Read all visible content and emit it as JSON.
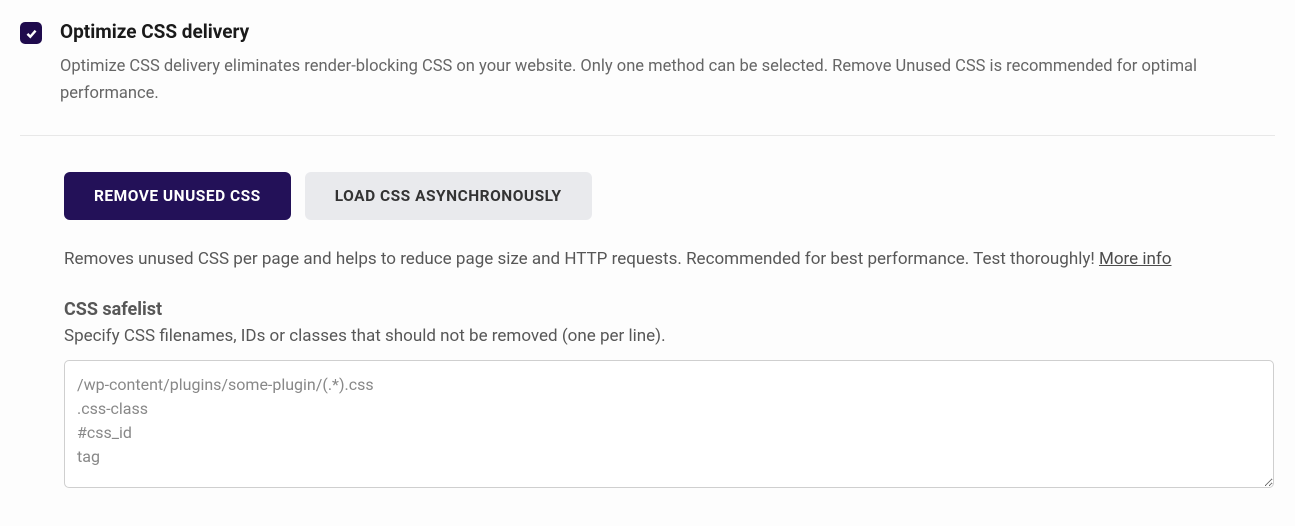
{
  "option": {
    "title": "Optimize CSS delivery",
    "description": "Optimize CSS delivery eliminates render-blocking CSS on your website. Only one method can be selected. Remove Unused CSS is recommended for optimal performance.",
    "checked": true
  },
  "tabs": {
    "remove_unused": "Remove Unused CSS",
    "load_async": "Load CSS Asynchronously"
  },
  "tab_description": "Removes unused CSS per page and helps to reduce page size and HTTP requests. Recommended for best performance. Test thoroughly! ",
  "more_info_label": "More info",
  "safelist": {
    "title": "CSS safelist",
    "description": "Specify CSS filenames, IDs or classes that should not be removed (one per line).",
    "placeholder": "/wp-content/plugins/some-plugin/(.*).css\n.css-class\n#css_id\ntag"
  }
}
